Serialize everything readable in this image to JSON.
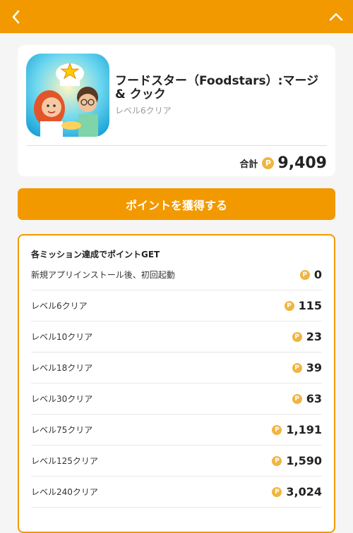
{
  "app": {
    "title": "フードスター（Foodstars）:マージ & クック",
    "status": "レベル6クリア",
    "icon": "foodstars-app-icon"
  },
  "total": {
    "label": "合計",
    "coin_symbol": "P",
    "value": "9,409"
  },
  "cta": {
    "label": "ポイントを獲得する"
  },
  "missions": {
    "header": "各ミッション達成でポイントGET",
    "coin_symbol": "P",
    "items": [
      {
        "label": "新規アプリインストール後、初回起動",
        "points": "0"
      },
      {
        "label": "レベル6クリア",
        "points": "115"
      },
      {
        "label": "レベル10クリア",
        "points": "23"
      },
      {
        "label": "レベル18クリア",
        "points": "39"
      },
      {
        "label": "レベル30クリア",
        "points": "63"
      },
      {
        "label": "レベル75クリア",
        "points": "1,191"
      },
      {
        "label": "レベル125クリア",
        "points": "1,590"
      },
      {
        "label": "レベル240クリア",
        "points": "3,024"
      }
    ]
  },
  "colors": {
    "accent": "#f29900",
    "coin": "#f0b542",
    "background": "#f5f5f5"
  }
}
